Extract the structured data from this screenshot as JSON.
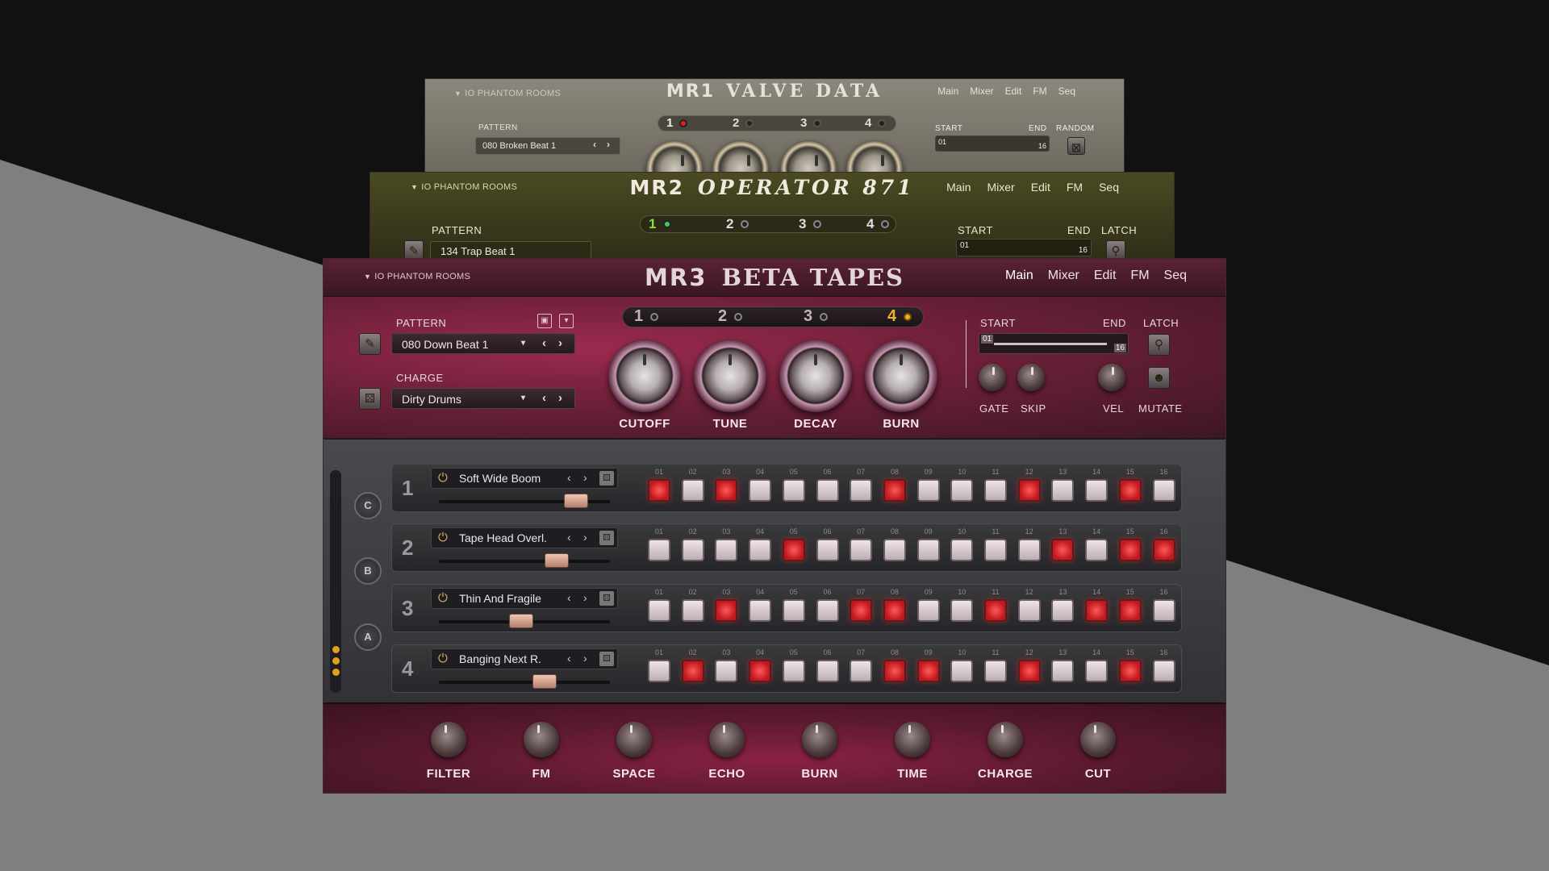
{
  "colors": {
    "page_top": "#111111",
    "page_diagonal": "#7f7f7f",
    "mr3_accent": "#b2365e",
    "mr2_accent": "#5a6a2a",
    "mr1_accent": "#8a8577",
    "step_on": "#d0202a",
    "led_amber": "#e0a020"
  },
  "mr1": {
    "brand": "IO PHANTOM ROOMS",
    "title_model": "MR1",
    "title_name": "VALVE DATA",
    "menu": [
      "Main",
      "Mixer",
      "Edit",
      "FM",
      "Seq"
    ],
    "pattern_label": "PATTERN",
    "pattern_value": "080 Broken Beat 1",
    "slots": [
      "1",
      "2",
      "3",
      "4"
    ],
    "start_label": "START",
    "end_label": "END",
    "random_label": "RANDOM",
    "start_value": "01",
    "end_value": "16"
  },
  "mr2": {
    "brand": "IO PHANTOM ROOMS",
    "title_model": "MR2",
    "title_name": "OPERATOR 871",
    "menu": [
      "Main",
      "Mixer",
      "Edit",
      "FM",
      "Seq"
    ],
    "pattern_label": "PATTERN",
    "pattern_value": "134 Trap Beat 1",
    "slots": [
      "1",
      "2",
      "3",
      "4"
    ],
    "start_label": "START",
    "end_label": "END",
    "latch_label": "LATCH",
    "start_value": "01",
    "end_value": "16"
  },
  "mr3": {
    "brand": "IO PHANTOM ROOMS",
    "title_model": "MR3",
    "title_name": "BETA TAPES",
    "menu": [
      "Main",
      "Mixer",
      "Edit",
      "FM",
      "Seq"
    ],
    "pattern_label": "PATTERN",
    "pattern_value": "080 Down Beat 1",
    "charge_label": "CHARGE",
    "charge_value": "Dirty Drums",
    "slots": [
      "1",
      "2",
      "3",
      "4"
    ],
    "active_slot": "4",
    "big_knobs": [
      "CUTOFF",
      "TUNE",
      "DECAY",
      "BURN"
    ],
    "start_label": "START",
    "end_label": "END",
    "latch_label": "LATCH",
    "start_value": "01",
    "end_value": "16",
    "small_knobs": [
      "GATE",
      "SKIP",
      "VEL"
    ],
    "mutate_label": "MUTATE",
    "side_buttons": [
      "C",
      "B",
      "A"
    ],
    "step_numbers": [
      "01",
      "02",
      "03",
      "04",
      "05",
      "06",
      "07",
      "08",
      "09",
      "10",
      "11",
      "12",
      "13",
      "14",
      "15",
      "16"
    ],
    "tracks": [
      {
        "num": "1",
        "name": "Soft Wide Boom",
        "level": 0.85,
        "steps": [
          1,
          0,
          1,
          0,
          0,
          0,
          0,
          1,
          0,
          0,
          0,
          1,
          0,
          0,
          1,
          0
        ]
      },
      {
        "num": "2",
        "name": "Tape Head Overl.",
        "level": 0.72,
        "steps": [
          0,
          0,
          0,
          0,
          1,
          0,
          0,
          0,
          0,
          0,
          0,
          0,
          1,
          0,
          1,
          1
        ]
      },
      {
        "num": "3",
        "name": "Thin And Fragile",
        "level": 0.48,
        "steps": [
          0,
          0,
          1,
          0,
          0,
          0,
          1,
          1,
          0,
          0,
          1,
          0,
          0,
          1,
          1,
          0
        ]
      },
      {
        "num": "4",
        "name": "Banging Next R.",
        "level": 0.64,
        "steps": [
          0,
          1,
          0,
          1,
          0,
          0,
          0,
          1,
          1,
          0,
          0,
          1,
          0,
          0,
          1,
          0
        ]
      }
    ],
    "bottom_knobs": [
      "FILTER",
      "FM",
      "SPACE",
      "ECHO",
      "BURN",
      "TIME",
      "CHARGE",
      "CUT"
    ]
  }
}
